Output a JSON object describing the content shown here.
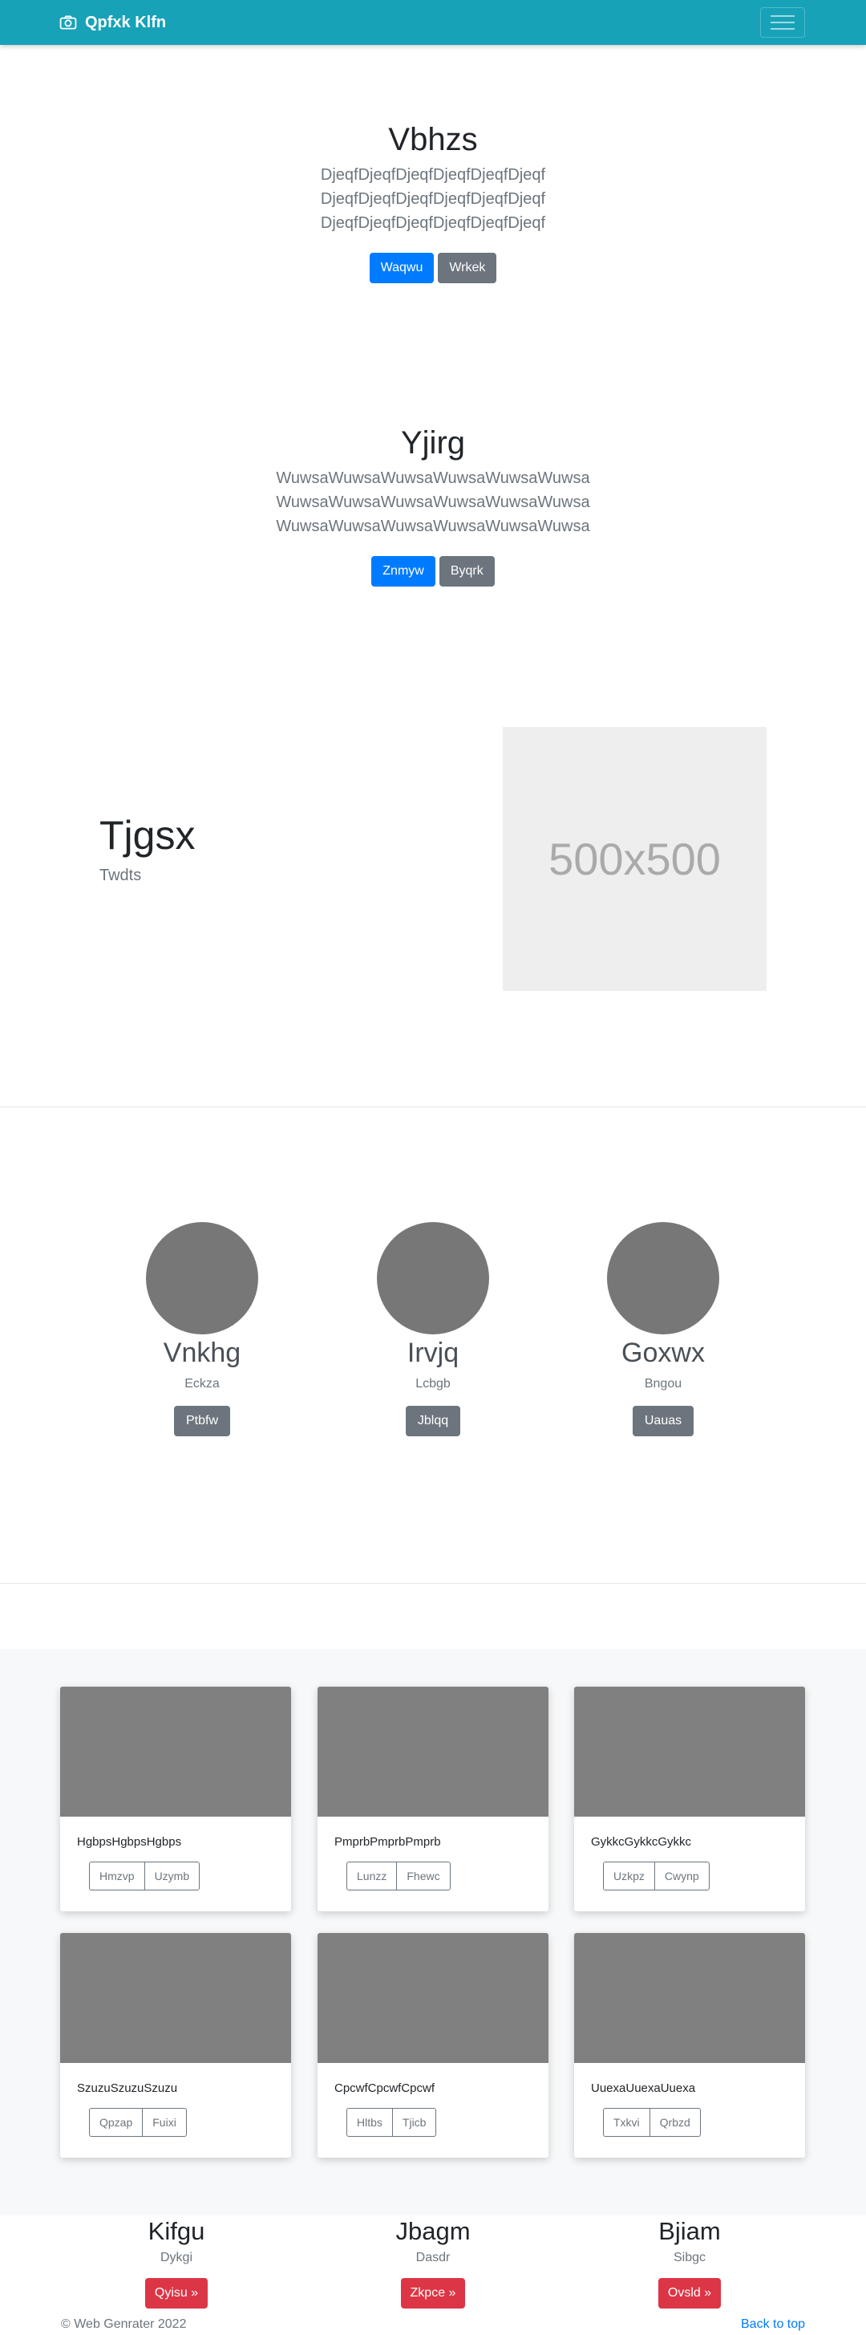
{
  "navbar": {
    "brand": "Qpfxk Klfn",
    "brand_icon": "camera-icon",
    "toggler_icon": "hamburger-icon"
  },
  "hero1": {
    "title": "Vbhzs",
    "lead_line1": "DjeqfDjeqfDjeqfDjeqfDjeqfDjeqf DjeqfDjeqfDjeqfDjeqfDjeqfDjeqf",
    "lead_line2": "DjeqfDjeqfDjeqfDjeqfDjeqfDjeqf",
    "primary": "Waqwu",
    "secondary": "Wrkek"
  },
  "hero2": {
    "title": "Yjirg",
    "lead_line1": "WuwsaWuwsaWuwsaWuwsaWuwsaWuwsa",
    "lead_line2": "WuwsaWuwsaWuwsaWuwsaWuwsaWuwsa",
    "lead_line3": "WuwsaWuwsaWuwsaWuwsaWuwsaWuwsa",
    "primary": "Znmyw",
    "secondary": "Byqrk"
  },
  "feature": {
    "title": "Tjgsx",
    "subtitle": "Twdts",
    "placeholder": "500x500"
  },
  "people": [
    {
      "name": "Vnkhg",
      "role": "Eckza",
      "button": "Ptbfw"
    },
    {
      "name": "Irvjq",
      "role": "Lcbgb",
      "button": "Jblqq"
    },
    {
      "name": "Goxwx",
      "role": "Bngou",
      "button": "Uauas"
    }
  ],
  "cards": [
    {
      "text": "HgbpsHgbpsHgbps",
      "b1": "Hmzvp",
      "b2": "Uzymb"
    },
    {
      "text": "PmprbPmprbPmprb",
      "b1": "Lunzz",
      "b2": "Fhewc"
    },
    {
      "text": "GykkcGykkcGykkc",
      "b1": "Uzkpz",
      "b2": "Cwynp"
    },
    {
      "text": "SzuzuSzuzuSzuzu",
      "b1": "Qpzap",
      "b2": "Fuixi"
    },
    {
      "text": "CpcwfCpcwfCpcwf",
      "b1": "Hltbs",
      "b2": "Tjicb"
    },
    {
      "text": "UuexaUuexaUuexa",
      "b1": "Txkvi",
      "b2": "Qrbzd"
    }
  ],
  "marketing": [
    {
      "title": "Kifgu",
      "sub": "Dykgi",
      "button": "Qyisu »"
    },
    {
      "title": "Jbagm",
      "sub": "Dasdr",
      "button": "Zkpce »"
    },
    {
      "title": "Bjiam",
      "sub": "Sibgc",
      "button": "Ovsld »"
    }
  ],
  "footer": {
    "copyright": "© Web Genrater 2022",
    "back_to_top": "Back to top"
  },
  "colors": {
    "navbar": "#17a2b8",
    "primary": "#007bff",
    "secondary": "#6c757d",
    "danger": "#dc3545"
  }
}
